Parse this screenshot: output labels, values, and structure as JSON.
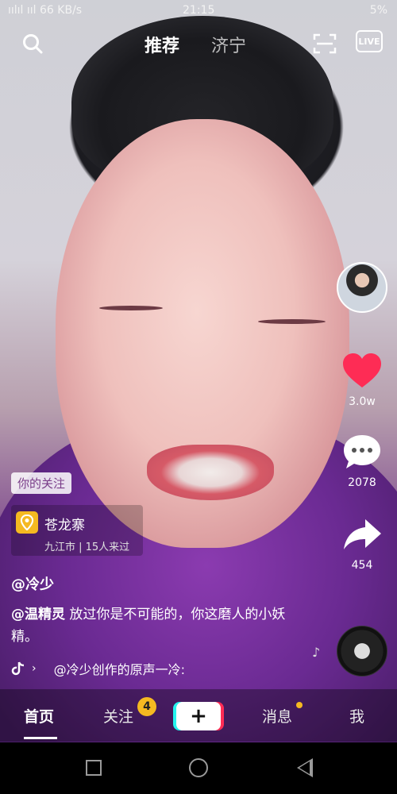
{
  "status_bar": {
    "left": "ıılıl ııl 66 KB/s",
    "time": "21:15",
    "right": "5%"
  },
  "top_nav": {
    "tab_recommend": "推荐",
    "tab_city": "济宁",
    "live_label": "LIVE"
  },
  "right_rail": {
    "like_count": "3.0w",
    "comment_count": "2078",
    "share_count": "454"
  },
  "post": {
    "follow_badge": "你的关注",
    "poi_name": "苍龙寨",
    "poi_sub": "九江市 | 15人来过",
    "author": "@冷少",
    "desc_mention": "@温精灵",
    "desc_text": " 放过你是不可能的，你这磨人的小妖精。",
    "music": "@冷少创作的原声一冷:"
  },
  "tab_bar": {
    "home": "首页",
    "follow": "关注",
    "follow_badge": "4",
    "plus": "+",
    "messages": "消息",
    "me": "我"
  },
  "icons": {
    "search": "search-icon",
    "scan": "scan-icon",
    "heart": "heart-icon",
    "comment": "comment-icon",
    "share": "share-icon",
    "location": "location-pin-icon",
    "music": "tiktok-note-icon"
  },
  "colors": {
    "like_red": "#fe2c55",
    "badge_yellow": "#f5b921"
  }
}
